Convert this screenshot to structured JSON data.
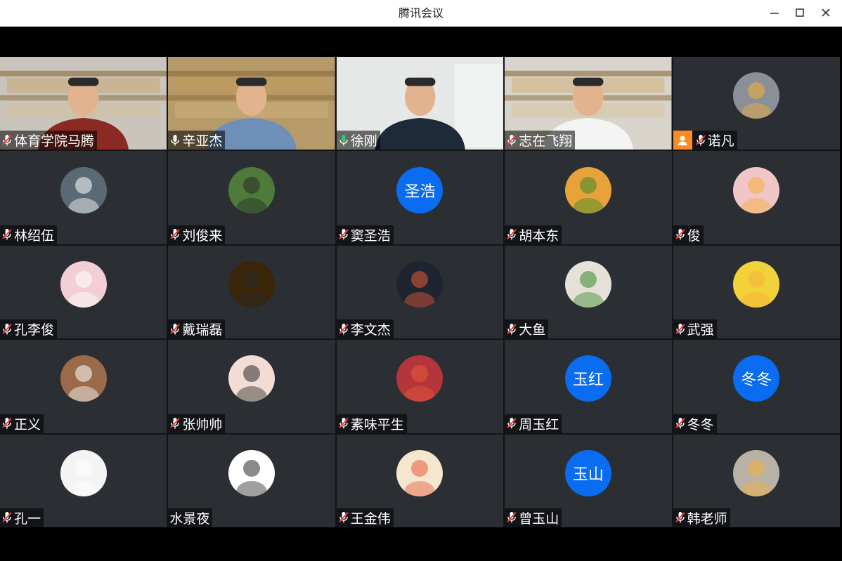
{
  "window": {
    "title": "腾讯会议"
  },
  "participants": [
    {
      "name": "体育学院马腾",
      "mic": "muted",
      "type": "video",
      "bg": "#c9c4bc"
    },
    {
      "name": "辛亚杰",
      "mic": "on",
      "type": "video",
      "bg": "#b79a6a"
    },
    {
      "name": "徐刚",
      "mic": "speaking",
      "type": "video",
      "bg": "#e5e8e6"
    },
    {
      "name": "志在飞翔",
      "mic": "muted",
      "type": "video",
      "bg": "#d9d4cb"
    },
    {
      "name": "诺凡",
      "mic": "muted",
      "type": "avatar",
      "host": true,
      "avatar_color": "#8a8f98"
    },
    {
      "name": "林绍伍",
      "mic": "muted",
      "type": "avatar",
      "avatar_color": "#5a6a74"
    },
    {
      "name": "刘俊来",
      "mic": "muted",
      "type": "avatar",
      "avatar_color": "#4e7a3a"
    },
    {
      "name": "窦圣浩",
      "mic": "muted",
      "type": "initials",
      "initials": "圣浩"
    },
    {
      "name": "胡本东",
      "mic": "muted",
      "type": "avatar",
      "avatar_color": "#e8a23a"
    },
    {
      "name": "俊",
      "mic": "muted",
      "type": "avatar",
      "avatar_color": "#f0c6c8"
    },
    {
      "name": "孔李俊",
      "mic": "muted",
      "type": "avatar",
      "avatar_color": "#f2cfd6"
    },
    {
      "name": "戴瑞磊",
      "mic": "muted",
      "type": "avatar",
      "avatar_color": "#3a2508"
    },
    {
      "name": "李文杰",
      "mic": "muted",
      "type": "avatar",
      "avatar_color": "#1f2530"
    },
    {
      "name": "大鱼",
      "mic": "muted",
      "type": "avatar",
      "avatar_color": "#e6e1d8"
    },
    {
      "name": "武强",
      "mic": "muted",
      "type": "avatar",
      "avatar_color": "#f2d23a"
    },
    {
      "name": "正义",
      "mic": "muted",
      "type": "avatar",
      "avatar_color": "#9a6a4a"
    },
    {
      "name": "张帅帅",
      "mic": "muted",
      "type": "avatar",
      "avatar_color": "#f3dcd4"
    },
    {
      "name": "素味平生",
      "mic": "muted",
      "type": "avatar",
      "avatar_color": "#b5363a"
    },
    {
      "name": "周玉红",
      "mic": "muted",
      "type": "initials",
      "initials": "玉红"
    },
    {
      "name": "冬冬",
      "mic": "muted",
      "type": "initials",
      "initials": "冬冬"
    },
    {
      "name": "孔一",
      "mic": "muted",
      "type": "avatar",
      "avatar_color": "#f4f4f4"
    },
    {
      "name": "水景夜",
      "mic": "none",
      "type": "avatar",
      "avatar_color": "#ffffff"
    },
    {
      "name": "王金伟",
      "mic": "muted",
      "type": "avatar",
      "avatar_color": "#f5e6cf"
    },
    {
      "name": "曾玉山",
      "mic": "muted",
      "type": "initials",
      "initials": "玉山"
    },
    {
      "name": "韩老师",
      "mic": "muted",
      "type": "avatar",
      "avatar_color": "#b8b2a6"
    }
  ]
}
